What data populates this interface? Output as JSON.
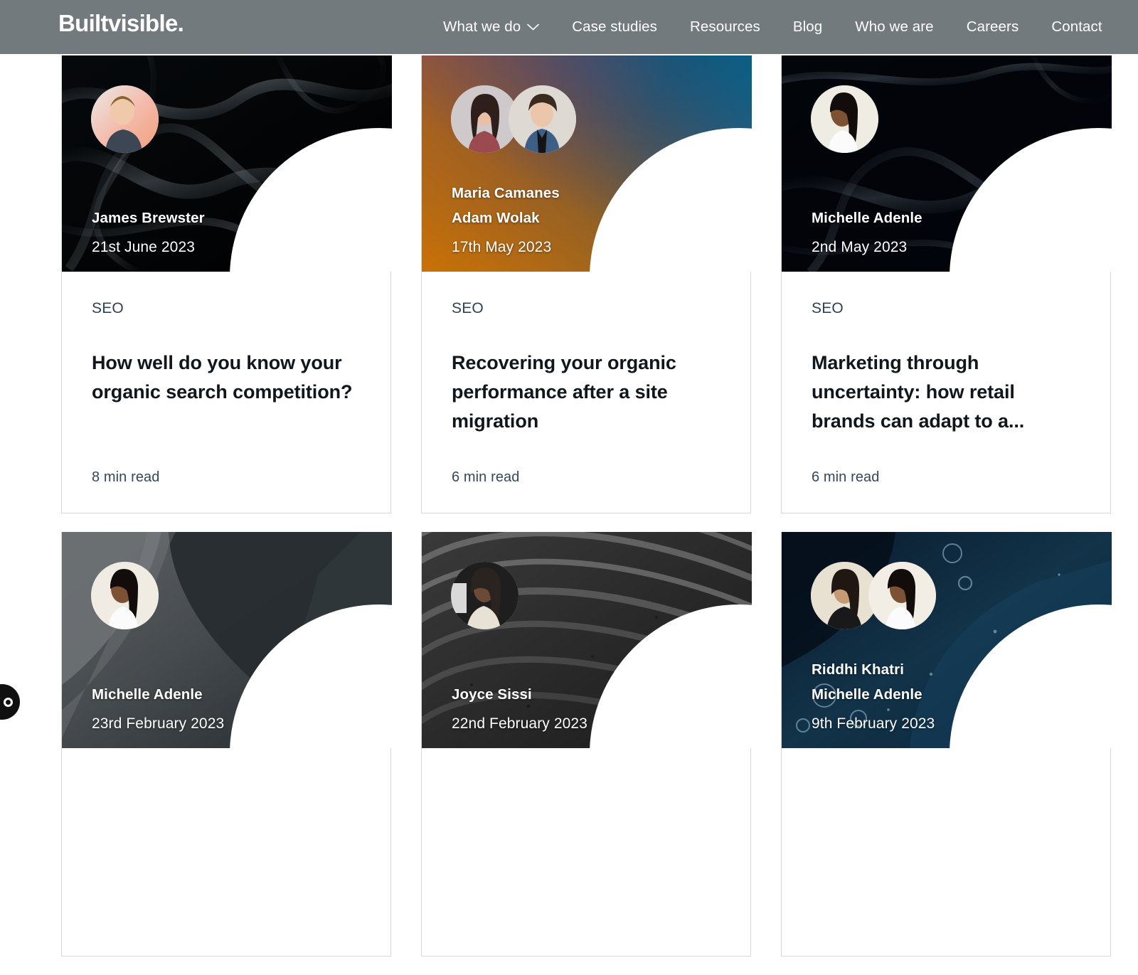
{
  "header": {
    "brand": "Builtvisible.",
    "nav": [
      {
        "label": "What we do",
        "has_chevron": true,
        "icon": "chevron-down-icon"
      },
      {
        "label": "Case studies",
        "has_chevron": false
      },
      {
        "label": "Resources",
        "has_chevron": false
      },
      {
        "label": "Blog",
        "has_chevron": false
      },
      {
        "label": "Who we are",
        "has_chevron": false
      },
      {
        "label": "Careers",
        "has_chevron": false
      },
      {
        "label": "Contact",
        "has_chevron": false
      }
    ],
    "background_color": "#737a7d",
    "text_color": "#ffffff"
  },
  "accessibility_widget": {
    "icon": "accessibility-circle-icon"
  },
  "colors": {
    "category": "#2c4354",
    "title": "#10171c",
    "read_time": "#33485a",
    "card_border": "#d8d8d8",
    "page_background": "#ffffff"
  },
  "cards": [
    {
      "authors": [
        "James Brewster"
      ],
      "date": "21st June 2023",
      "category": "SEO",
      "title": "How well do you know your organic search competition?",
      "read_time": "8 min read",
      "media_style": "black-smoke",
      "avatar_count": 1
    },
    {
      "authors": [
        "Maria Camanes",
        "Adam Wolak"
      ],
      "date": "17th May 2023",
      "category": "SEO",
      "title": "Recovering your organic performance after a site migration",
      "read_time": "6 min read",
      "media_style": "orange-teal-gradient",
      "avatar_count": 2
    },
    {
      "authors": [
        "Michelle Adenle"
      ],
      "date": "2nd May 2023",
      "category": "SEO",
      "title": "Marketing through uncertainty: how retail brands can adapt to a...",
      "read_time": "6 min read",
      "media_style": "dark-smoke",
      "avatar_count": 1
    },
    {
      "authors": [
        "Michelle Adenle"
      ],
      "date": "23rd February 2023",
      "category": "",
      "title": "",
      "read_time": "",
      "media_style": "grey-fabric",
      "avatar_count": 1
    },
    {
      "authors": [
        "Joyce Sissi"
      ],
      "date": "22nd February 2023",
      "category": "",
      "title": "",
      "read_time": "",
      "media_style": "grey-sand-ripples",
      "avatar_count": 1
    },
    {
      "authors": [
        "Riddhi Khatri",
        "Michelle Adenle"
      ],
      "date": "9th February 2023",
      "category": "",
      "title": "",
      "read_time": "",
      "media_style": "dark-blue-bubbles",
      "avatar_count": 2
    }
  ]
}
